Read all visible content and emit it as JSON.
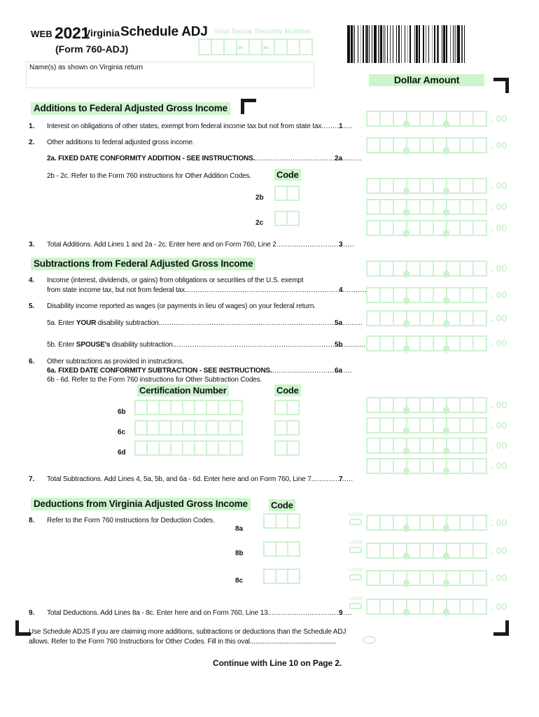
{
  "header": {
    "web_tag": "WEB",
    "year": "2021",
    "state": "Virginia",
    "schedule": "Schedule ADJ",
    "form_sub": "(Form 760-ADJ)",
    "ssn_label": "Your Social Security Number",
    "ssn_cells": 9,
    "name_label": "Name(s) as shown on Virginia return",
    "name_value": ""
  },
  "right_column": {
    "dollar_amount_heading": "Dollar Amount",
    "cents_suffix": ". 00",
    "loss_label": "LOSS"
  },
  "sections": [
    {
      "id": "additions",
      "title": "Additions to Federal Adjusted Gross Income"
    },
    {
      "id": "subtractions",
      "title": "Subtractions from Federal Adjusted Gross Income"
    },
    {
      "id": "deductions",
      "title": "Deductions from Virginia Adjusted Gross Income"
    }
  ],
  "group_labels": {
    "code": "Code",
    "certification_number": "Certification Number",
    "deduction_code": "Code"
  },
  "lines": {
    "l1_no": "1.",
    "l1_text": "Interest on obligations of other states, exempt from federal income tax but not from state tax",
    "l1_dots": "..............",
    "l1_end": "1",
    "l2_no": "2.",
    "l2_text": "Other additions to federal adjusted gross income.",
    "l2a_text_a": "2a. ",
    "l2a_text_b": "FIXED DATE CONFORMITY ADDITION - SEE INSTRUCTIONS.",
    "l2a_dots": "................................................",
    "l2a_end": "2a",
    "l2bc_text": "2b - 2c. Refer to the Form 760 instructions for Other Addition Codes.",
    "tag_2b": "2b",
    "tag_2c": "2c",
    "l3_no": "3.",
    "l3_text": "Total Additions. Add Lines 1 and 2a - 2c. Enter here and on Form 760, Line 2",
    "l3_dots": "...................................",
    "l3_end": "3",
    "l4_no": "4.",
    "l4_text_1": "Income (interest, dividends, or gains) from obligations or securities of the U.S. exempt",
    "l4_text_2": "from state income tax, but not from federal tax.",
    "l4_dots": ".......................................................................................",
    "l4_end": "4",
    "l5_no": "5.",
    "l5_text": "Disability income reported as wages (or payments in lieu of wages) on your federal return.",
    "l5a_text_a": "5a. Enter ",
    "l5a_text_b": "YOUR",
    "l5a_text_c": " disability subtraction.",
    "l5a_dots": "...........................................................................................",
    "l5a_end": "5a",
    "l5b_text_a": "5b. Enter ",
    "l5b_text_b": "SPOUSE's",
    "l5b_text_c": " disability subtraction.",
    "l5b_dots": "......................................................................................",
    "l5b_end": "5b",
    "l6_no": "6.",
    "l6_text": "Other subtractions as provided in instructions.",
    "l6a_text_a": "6a. ",
    "l6a_text_b": "FIXED DATE CONFORMITY SUBTRACTION - SEE INSTRUCTIONS.",
    "l6a_dots": "....................................",
    "l6a_end": "6a",
    "l6bd_text": "6b - 6d. Refer to the Form 760 instructions for Other Subtraction Codes.",
    "tag_6b": "6b",
    "tag_6c": "6c",
    "tag_6d": "6d",
    "l7_no": "7.",
    "l7_text": "Total Subtractions. Add Lines 4, 5a, 5b, and 6a - 6d. Enter here and on Form 760, Line 7.",
    "l7_dots": "..................",
    "l7_end": "7",
    "l8_no": "8.",
    "l8_text": "Refer to the Form 760 instructions for Deduction Codes.",
    "tag_8a": "8a",
    "tag_8b": "8b",
    "tag_8c": "8c",
    "l9_no": "9.",
    "l9_text": "Total Deductions. Add Lines 8a - 8c. Enter here and on Form 760, Line 13.",
    "l9_dots": ".....................................",
    "l9_end": "9",
    "adjs_text_1": "Use Schedule ADJS if you are claiming more additions, subtractions or deductions than the  Schedule ADJ",
    "adjs_text_2": "allows. Refer to the Form 760 Instructions for Other Codes. Fill in this oval.",
    "adjs_dots": "..............................................",
    "continue_text": "Continue with Line 10 on Page 2."
  },
  "colors": {
    "form_green": "#cdf2d0",
    "highlight_green": "#ccf5cc",
    "text_black": "#111111"
  }
}
